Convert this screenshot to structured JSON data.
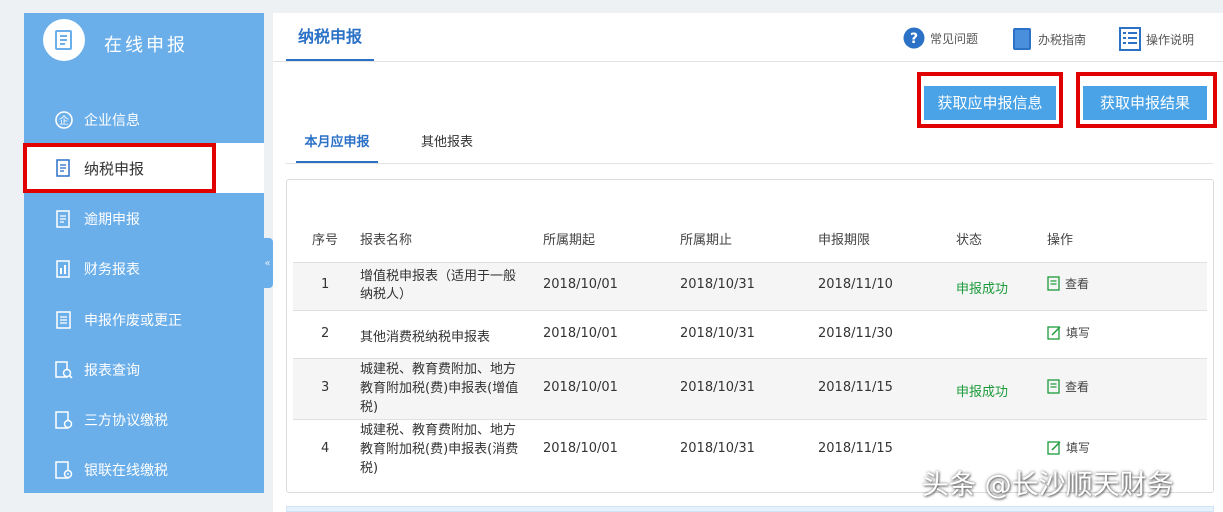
{
  "sidebar": {
    "title": "在线申报",
    "items": [
      {
        "label": "企业信息",
        "icon": "enterprise-icon"
      },
      {
        "label": "纳税申报",
        "icon": "tax-declare-icon",
        "active": true
      },
      {
        "label": "逾期申报",
        "icon": "overdue-icon"
      },
      {
        "label": "财务报表",
        "icon": "finance-report-icon"
      },
      {
        "label": "申报作废或更正",
        "icon": "void-correct-icon"
      },
      {
        "label": "报表查询",
        "icon": "report-query-icon"
      },
      {
        "label": "三方协议缴税",
        "icon": "tripartite-icon"
      },
      {
        "label": "银联在线缴税",
        "icon": "unionpay-icon"
      }
    ],
    "collapse_glyph": "«"
  },
  "header": {
    "title": "纳税申报",
    "links": [
      {
        "label": "常见问题",
        "icon": "question-icon"
      },
      {
        "label": "办税指南",
        "icon": "book-icon"
      },
      {
        "label": "操作说明",
        "icon": "list-doc-icon"
      }
    ]
  },
  "actions": {
    "fetch_info": "获取应申报信息",
    "fetch_result": "获取申报结果"
  },
  "tabs": [
    "本月应申报",
    "其他报表"
  ],
  "table": {
    "headers": [
      "序号",
      "报表名称",
      "所属期起",
      "所属期止",
      "申报期限",
      "状态",
      "操作"
    ],
    "rows": [
      {
        "no": "1",
        "name": [
          "增值税申报表（适用于一般",
          "纳税人）"
        ],
        "start": "2018/10/01",
        "end": "2018/10/31",
        "deadline": "2018/11/10",
        "status": "申报成功",
        "action": "查看"
      },
      {
        "no": "2",
        "name": [
          "其他消费税纳税申报表"
        ],
        "start": "2018/10/01",
        "end": "2018/10/31",
        "deadline": "2018/11/30",
        "status": "",
        "action": "填写"
      },
      {
        "no": "3",
        "name": [
          "城建税、教育费附加、地方",
          "教育附加税(费)申报表(增值",
          "税)"
        ],
        "start": "2018/10/01",
        "end": "2018/10/31",
        "deadline": "2018/11/15",
        "status": "申报成功",
        "action": "查看"
      },
      {
        "no": "4",
        "name": [
          "城建税、教育费附加、地方",
          "教育附加税(费)申报表(消费",
          "税)"
        ],
        "start": "2018/10/01",
        "end": "2018/10/31",
        "deadline": "2018/11/15",
        "status": "",
        "action": "填写"
      }
    ]
  },
  "watermark": "头条 @长沙顺天财务",
  "colors": {
    "sidebar": "#6aaeea",
    "accent": "#2b71c6",
    "button": "#4aa3e6",
    "highlight": "#e00000",
    "success": "#1b9b3a"
  }
}
